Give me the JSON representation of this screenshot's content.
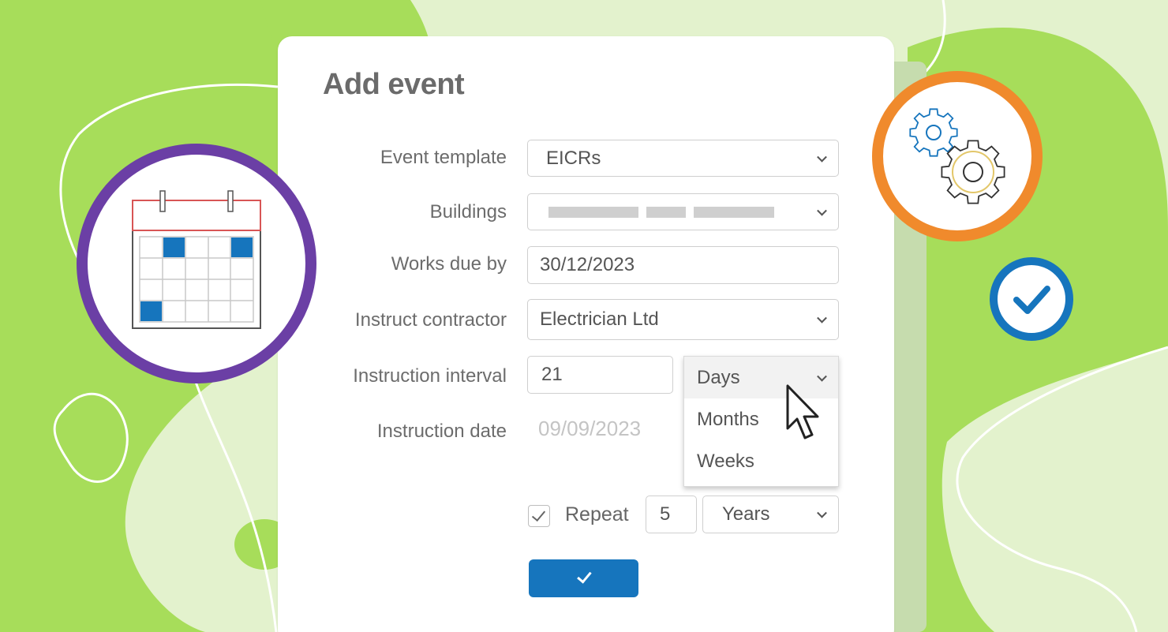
{
  "form": {
    "title": "Add event",
    "event_template": {
      "label": "Event template",
      "value": "EICRs"
    },
    "buildings": {
      "label": "Buildings",
      "value_redacted": true
    },
    "works_due_by": {
      "label": "Works due by",
      "value": "30/12/2023"
    },
    "instruct_contractor": {
      "label": "Instruct contractor",
      "value": "Electrician Ltd"
    },
    "instruction_interval": {
      "label": "Instruction interval",
      "value": "21",
      "unit_selected": "Days",
      "unit_options": [
        "Months",
        "Weeks"
      ]
    },
    "instruction_date": {
      "label": "Instruction date",
      "value": "09/09/2023"
    },
    "repeat": {
      "checked": true,
      "label": "Repeat",
      "count": "5",
      "unit": "Years"
    },
    "submit": {
      "icon": "check-icon"
    }
  },
  "decorations": {
    "calendar_badge": {
      "icon": "calendar-icon",
      "ring_color": "#6b3fa5"
    },
    "gears_badge": {
      "icon": "gears-icon",
      "ring_color": "#f08a2c"
    },
    "check_badge": {
      "icon": "check-circle-icon",
      "ring_color": "#1675bd"
    }
  },
  "colors": {
    "accent": "#1675bd",
    "background_green": "#a7dd5a",
    "background_light": "#e3f2cd"
  }
}
